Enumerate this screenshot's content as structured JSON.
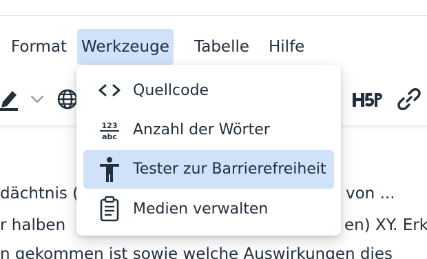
{
  "menubar": {
    "items": [
      {
        "label": "Format"
      },
      {
        "label": "Werkzeuge"
      },
      {
        "label": "Tabelle"
      },
      {
        "label": "Hilfe"
      }
    ]
  },
  "toolbar": {
    "icons": [
      "highlight-pen-icon",
      "chevron-down-icon",
      "globe-icon",
      "h5p-icon",
      "link-icon"
    ],
    "h5p_label": "H-P"
  },
  "tools_menu": {
    "items": [
      {
        "label": "Quellcode",
        "icon": "code-icon"
      },
      {
        "label": "Anzahl der Wörter",
        "icon": "word-count-icon",
        "icon_text_top": "123",
        "icon_text_bottom": "abc"
      },
      {
        "label": "Tester zur Barrierefreiheit",
        "icon": "accessibility-icon"
      },
      {
        "label": "Medien verwalten",
        "icon": "clipboard-icon"
      }
    ]
  },
  "editor": {
    "lines": [
      {
        "left": "dächtnis (",
        "right": "von ..."
      },
      {
        "left": "r halben",
        "right": "en) XY. Erk"
      },
      {
        "left": "n gekommen ist sowie welche Auswirkungen dies"
      }
    ]
  },
  "colors": {
    "text": "#222f3e",
    "highlight": "#cfe2fa",
    "border": "#e3e3e3"
  }
}
